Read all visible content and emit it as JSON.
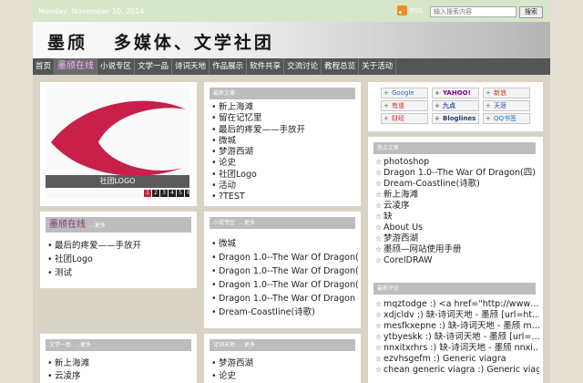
{
  "topbar": {
    "date": "Monday, November 10, 2014",
    "rss_label": "RSS",
    "search_placeholder": "输入搜索内容",
    "search_button": "搜索"
  },
  "header": {
    "title": "墨颀   多媒体、文学社团"
  },
  "nav": [
    {
      "label": "首页"
    },
    {
      "label": "墨颀在线"
    },
    {
      "label": "小说专区"
    },
    {
      "label": "文学一品"
    },
    {
      "label": "诗词天地"
    },
    {
      "label": "作品展示"
    },
    {
      "label": "软件共享"
    },
    {
      "label": "交流讨论"
    },
    {
      "label": "教程总览"
    },
    {
      "label": "关于活动"
    }
  ],
  "slider": {
    "caption": "社团LOGO",
    "dots": [
      "1",
      "2",
      "3",
      "4",
      "5",
      "6"
    ]
  },
  "latest": {
    "title": "最新文章",
    "items": [
      "新上海滩",
      "留在记忆里",
      "最后的疼爱——手放开",
      "微城",
      "梦游西湖",
      "论史",
      "社团Logo",
      "活动",
      "?TEST"
    ]
  },
  "online": {
    "title": "墨颀在线",
    "more": "…更多",
    "items": [
      "最后的疼爱——手放开",
      "社团Logo",
      "测试"
    ]
  },
  "novel": {
    "title": "小说专区",
    "more": "…更多",
    "items": [
      "微城",
      "Dragon 1.0--The War Of Dragon(…",
      "Dragon 1.0--The War Of Dragon(…",
      "Dragon 1.0--The War Of Dragon(…",
      "Dragon 1.0--The War Of Dragon —",
      "Dream-Coastline(诗歌)"
    ]
  },
  "literature": {
    "title": "文学一品",
    "more": "…更多",
    "items": [
      "新上海滩",
      "云凌序"
    ]
  },
  "poetry": {
    "title": "诗词天地",
    "more": "…更多",
    "items": [
      "梦游西湖",
      "论史"
    ]
  },
  "engines": [
    "Google",
    "YAHOO!",
    "新浪",
    "有道",
    "九点",
    "天涯",
    "财经",
    "Bloglines",
    "QQ书签"
  ],
  "hot": {
    "title": "热点文章",
    "items": [
      "photoshop",
      "Dragon 1.0--The War Of Dragon(四)",
      "Dream-Coastline(诗歌)",
      "新上海滩",
      "云凌序",
      "缺",
      "About Us",
      "梦游西湖",
      "墨颀—网站使用手册",
      "CorelDRAW"
    ]
  },
  "comments": {
    "title": "最新评论",
    "items": [
      "mqztodge :) <a href=\"http://www…",
      "xdjcldv :) 缺-诗词天地 - 墨颀 [url=ht…",
      "mesfkxepne :) 缺-诗词天地 - 墨颀 m…",
      "ytbyeskk :) 缺-诗词天地 - 墨颀 [url=…",
      "nnxitxrhrs :) 缺-诗词天地 - 墨颀 nnxi…",
      "ezvhsgefm :) Generic viagra",
      "chean generic viagra :) Generic viagra"
    ]
  },
  "colors": {
    "nav_active": "#ffb3ff",
    "logo_red": "#cc2244",
    "panel_head": "#bdbdbd"
  }
}
